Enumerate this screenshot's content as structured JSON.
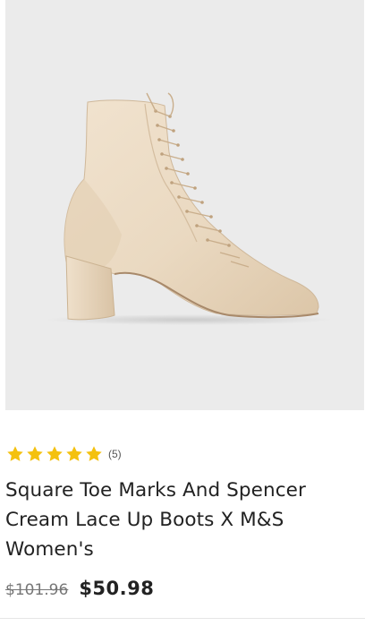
{
  "product": {
    "image_alt": "Cream lace up square toe ankle boot",
    "rating": {
      "stars": 5,
      "max_stars": 5,
      "review_count_text": "(5)",
      "star_color": "#f4c10f"
    },
    "title": "Square Toe Marks And Spencer Cream Lace Up Boots X M&S Women's",
    "price": {
      "original": "$101.96",
      "current": "$50.98"
    }
  },
  "colors": {
    "image_background": "#ebebeb",
    "boot_leather": "#ecdcc6",
    "text_primary": "#222222",
    "text_muted": "#777777"
  }
}
